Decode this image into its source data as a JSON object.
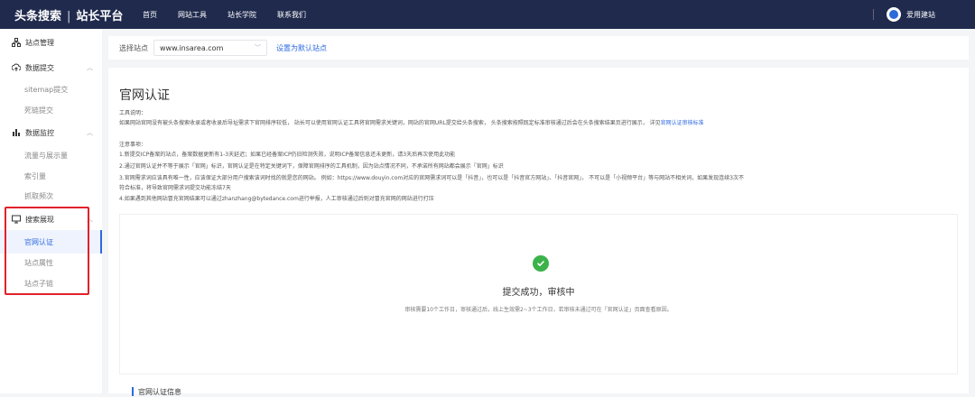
{
  "header": {
    "brand": "头条搜索",
    "brand_sep": "|",
    "brand_sub": "站长平台",
    "nav": [
      "首页",
      "网站工具",
      "站长学院",
      "联系我们"
    ],
    "user_name": "爱用建站"
  },
  "sidebar": {
    "site_manage": "站点管理",
    "data_submit": "数据提交",
    "data_submit_items": [
      "sitemap提交",
      "死链提交"
    ],
    "data_monitor": "数据监控",
    "data_monitor_items": [
      "流量与展示量",
      "索引量",
      "抓取频次"
    ],
    "search_display": "搜索展现",
    "search_display_items": [
      "官网认证",
      "站点属性",
      "站点子链"
    ]
  },
  "site_selector": {
    "label": "选择站点",
    "value": "www.insarea.com",
    "default_link": "设置为默认站点"
  },
  "main": {
    "title": "官网认证",
    "tool_desc_label": "工具说明：",
    "tool_desc": "如果网站官网没有被头条搜索收录或者收录后导址需求下官网排序较低， 站长可以使用官网认证工具将官网需求关键词，网站的官网URL提交给头条搜索， 头条搜索按照既定标准审核通过后会在头条搜索结果页进行展示， 详见",
    "tool_desc_link": "官网认证审核标准",
    "notes_label": "注意事项：",
    "notes": [
      "1.新提交ICP备案的站点，备案数据更新有1-3天延迟；如果已经备案ICP仍旧检测失败，说明ICP备案信息还未更新，请3天后再次使用此功能",
      "2.通过官网认证并不等于展示「官网」标识，官网认证是在特定关键词下，保障官网排序的工具机制，因为站点情况不同，不承诺所有网站都会展示「官网」标识",
      "3.官网需求词应该具有唯一性，应该保证大部分用户搜索该词时找的就是您的网站。 例如：https://www.douyin.com对应的官网需求词可以是「抖音」，也可以是「抖音官方网站」、「抖音官网」， 不可以是「小视频平台」等与网站不相关词，如果发现连续3次不",
      "符合标准，将导致官网需求词提交功能冻结7天",
      "4.如果遇到其他网站冒充官网结果可以通过zhanzhang@bytedance.com进行举报，人工审核通过后则对冒充官网的网站进行打压"
    ],
    "status_title": "提交成功，审核中",
    "status_desc": "审核需要10个工作日，审核通过后，线上生效需2~3个工作日，若审核未通过可在「官网认证」页面查看原因。",
    "info_title": "官网认证信息"
  }
}
